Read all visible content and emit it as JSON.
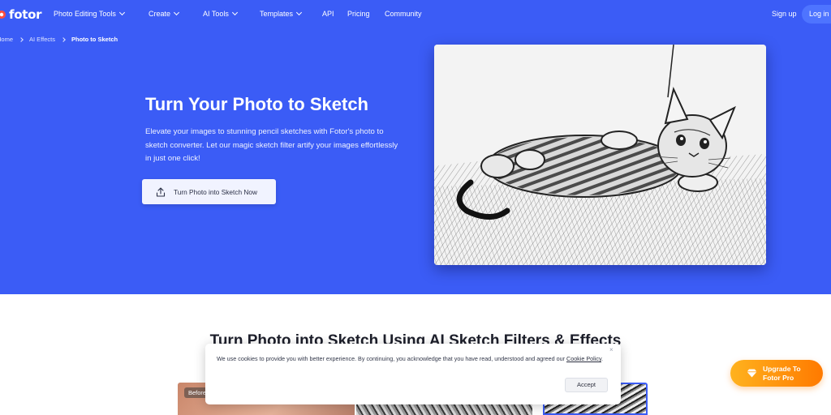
{
  "brand": {
    "name": "fotor"
  },
  "nav": {
    "items": [
      {
        "label": "Photo Editing Tools",
        "dropdown": true
      },
      {
        "label": "Create",
        "dropdown": true
      },
      {
        "label": "AI Tools",
        "dropdown": true
      },
      {
        "label": "Templates",
        "dropdown": true
      },
      {
        "label": "API",
        "dropdown": false
      },
      {
        "label": "Pricing",
        "dropdown": false
      },
      {
        "label": "Community",
        "dropdown": false
      }
    ],
    "signup": "Sign up",
    "login": "Log in"
  },
  "breadcrumb": {
    "home": "Home",
    "parent": "AI Effects",
    "current": "Photo to Sketch"
  },
  "hero": {
    "title": "Turn Your Photo to Sketch",
    "description": "Elevate your images to stunning pencil sketches with Fotor's photo to sketch converter. Let our magic sketch filter artify your images effortlessly in just one click!",
    "cta_label": "Turn Photo into Sketch Now",
    "cta_icon": "upload-icon",
    "image_alt": "cat-sketch-image"
  },
  "section": {
    "title": "Turn Photo into Sketch Using AI Sketch Filters & Effects",
    "before_label": "Before"
  },
  "cookie": {
    "text": "We use cookies to provide you with better experience. By continuing, you acknowledge that you have read, understood and agreed our ",
    "link": "Cookie Policy",
    "suffix": ".",
    "accept": "Accept",
    "close": "×"
  },
  "upgrade": {
    "line1": "Upgrade To",
    "line2": "Fotor Pro",
    "icon": "diamond-icon"
  },
  "colors": {
    "hero_bg": "#3b5cf6",
    "accent": "#4e74ff",
    "upgrade": "#ff9a0d"
  }
}
